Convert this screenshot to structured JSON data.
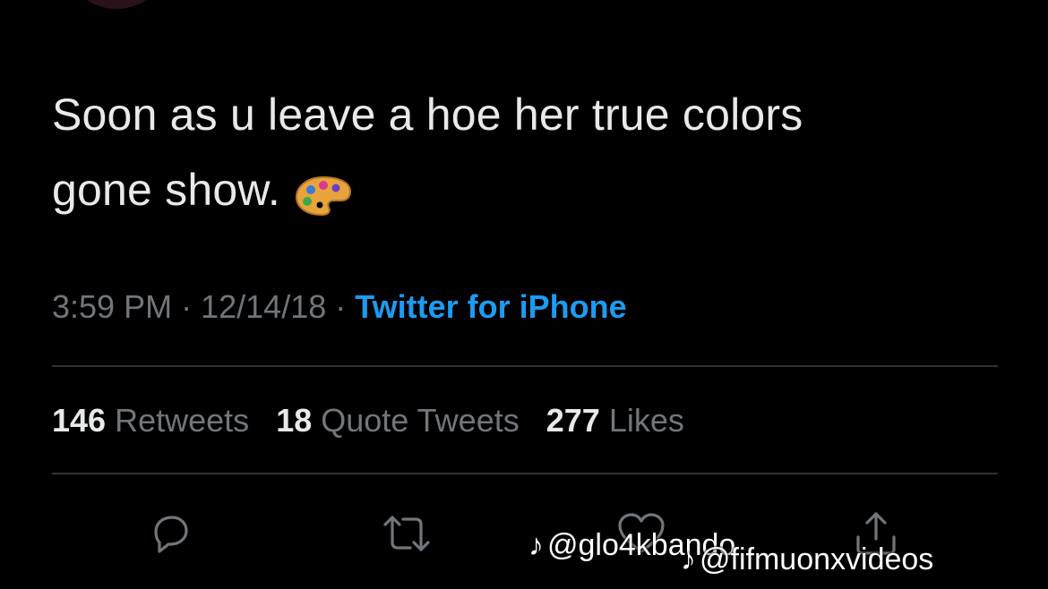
{
  "tweet": {
    "text_line1": "Soon as u leave a hoe her true colors",
    "text_line2": "gone show.",
    "emoji": "artist-palette-emoji",
    "time": "3:59 PM",
    "separator": "·",
    "date": "12/14/18",
    "source": "Twitter for iPhone"
  },
  "stats": {
    "retweets_count": "146",
    "retweets_label": "Retweets",
    "quotes_count": "18",
    "quotes_label": "Quote Tweets",
    "likes_count": "277",
    "likes_label": "Likes"
  },
  "actions": {
    "reply_icon": "reply-icon",
    "retweet_icon": "retweet-icon",
    "like_icon": "heart-icon",
    "share_icon": "share-icon"
  },
  "watermarks": {
    "first": "@glo4kbando",
    "second": "@fifmuonxvideos",
    "logo": "tiktok-logo"
  },
  "colors": {
    "background": "#000000",
    "text": "#e7e9ea",
    "secondary": "#71767b",
    "link": "#1d9bf0",
    "divider": "#2f3336"
  }
}
